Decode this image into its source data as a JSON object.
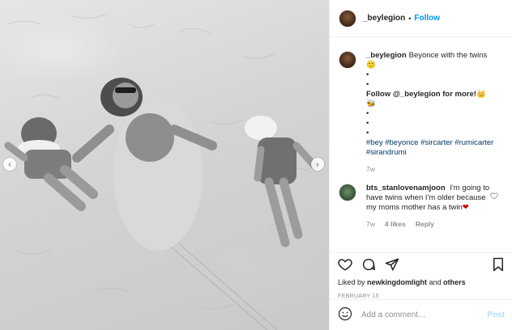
{
  "post": {
    "username": "_beylegion",
    "follow_label": "Follow",
    "dot": "•"
  },
  "caption": {
    "username": "_beylegion",
    "text": "Beyonce with the twins",
    "emoji_1": "🙂",
    "bullets": [
      "•",
      "•",
      "•",
      "•",
      "•"
    ],
    "promo": "Follow @_beylegion for more!",
    "emoji_crown": "👑",
    "emoji_bee": "🐝",
    "hashtags_line1": "#bey #beyonce #sircarter #rumicarter",
    "hashtags_line2": "#sirandrumi",
    "time": "7w"
  },
  "comment": {
    "username": "bts_stanlovenamjoon",
    "text": "I'm going to have twins when I'm older because my moms mother has a twin",
    "emoji_heart": "❤",
    "time": "7w",
    "likes": "4 likes",
    "reply": "Reply"
  },
  "actions": {
    "liked_by_prefix": "Liked by",
    "liked_by_user": "newkingdomlight",
    "and": "and",
    "others": "others",
    "date": "FEBRUARY 15"
  },
  "add_comment": {
    "placeholder": "Add a comment…",
    "post_label": "Post",
    "emoji_icon": "smiley-icon"
  },
  "icons": [
    "heart-icon",
    "comment-icon",
    "share-icon",
    "bookmark-icon",
    "chevron-left-icon",
    "chevron-right-icon"
  ]
}
